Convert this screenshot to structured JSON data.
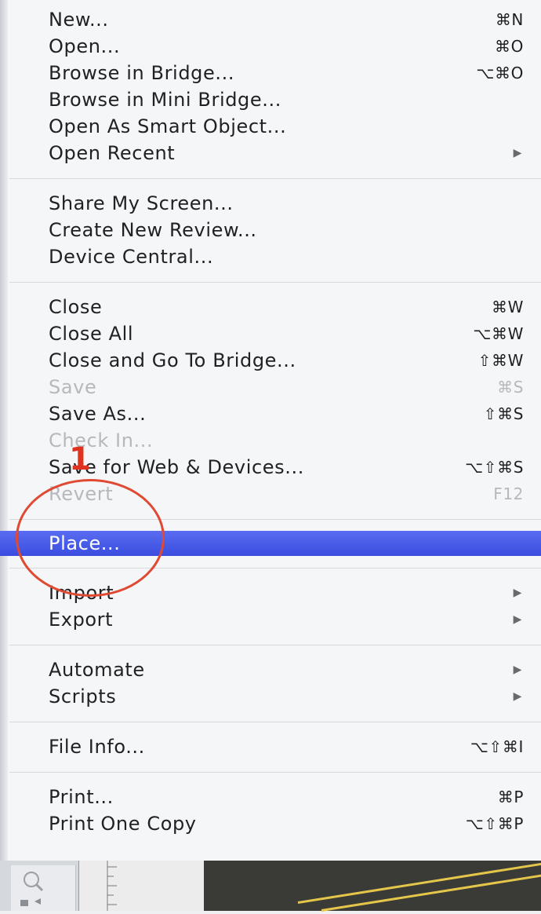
{
  "menu": {
    "groups": [
      {
        "items": [
          {
            "label": "New...",
            "shortcut": "⌘N"
          },
          {
            "label": "Open...",
            "shortcut": "⌘O"
          },
          {
            "label": "Browse in Bridge...",
            "shortcut": "⌥⌘O"
          },
          {
            "label": "Browse in Mini Bridge...",
            "shortcut": ""
          },
          {
            "label": "Open As Smart Object...",
            "shortcut": ""
          },
          {
            "label": "Open Recent",
            "shortcut": "",
            "submenu": true
          }
        ]
      },
      {
        "items": [
          {
            "label": "Share My Screen...",
            "shortcut": ""
          },
          {
            "label": "Create New Review...",
            "shortcut": ""
          },
          {
            "label": "Device Central...",
            "shortcut": ""
          }
        ]
      },
      {
        "items": [
          {
            "label": "Close",
            "shortcut": "⌘W"
          },
          {
            "label": "Close All",
            "shortcut": "⌥⌘W"
          },
          {
            "label": "Close and Go To Bridge...",
            "shortcut": "⇧⌘W"
          },
          {
            "label": "Save",
            "shortcut": "⌘S",
            "disabled": true
          },
          {
            "label": "Save As...",
            "shortcut": "⇧⌘S"
          },
          {
            "label": "Check In...",
            "shortcut": "",
            "disabled": true
          },
          {
            "label": "Save for Web & Devices...",
            "shortcut": "⌥⇧⌘S"
          },
          {
            "label": "Revert",
            "shortcut": "F12",
            "disabled": true
          }
        ]
      },
      {
        "items": [
          {
            "label": "Place...",
            "shortcut": "",
            "highlighted": true
          }
        ]
      },
      {
        "items": [
          {
            "label": "Import",
            "shortcut": "",
            "submenu": true
          },
          {
            "label": "Export",
            "shortcut": "",
            "submenu": true
          }
        ]
      },
      {
        "items": [
          {
            "label": "Automate",
            "shortcut": "",
            "submenu": true
          },
          {
            "label": "Scripts",
            "shortcut": "",
            "submenu": true
          }
        ]
      },
      {
        "items": [
          {
            "label": "File Info...",
            "shortcut": "⌥⇧⌘I"
          }
        ]
      },
      {
        "items": [
          {
            "label": "Print...",
            "shortcut": "⌘P"
          },
          {
            "label": "Print One Copy",
            "shortcut": "⌥⇧⌘P"
          }
        ]
      }
    ]
  },
  "annotation": {
    "step_number": "1",
    "color": "#e0321c"
  },
  "icons": {
    "submenu_arrow": "▶"
  },
  "colors": {
    "highlight": "#3f52e4",
    "disabled_text": "#b6b8bc"
  }
}
